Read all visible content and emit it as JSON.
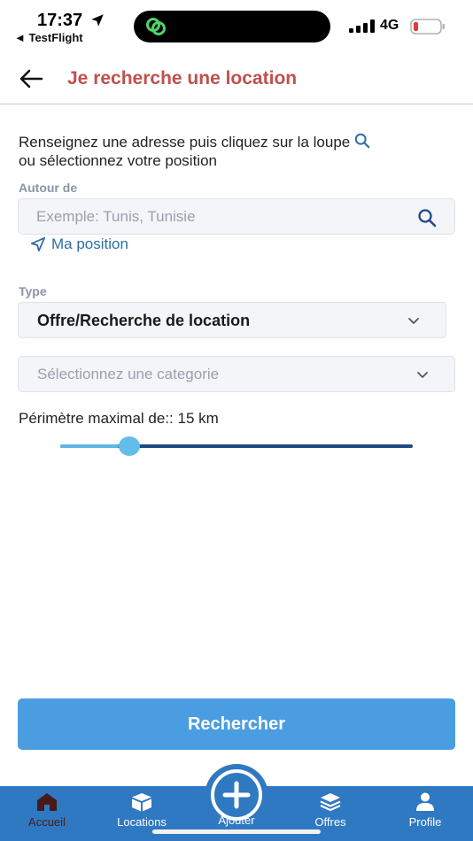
{
  "status_bar": {
    "time": "17:37",
    "back_app": "◄ TestFlight",
    "network": "4G"
  },
  "header": {
    "title": "Je recherche une location"
  },
  "form": {
    "instructions_line1": "Renseignez une adresse puis cliquez sur la loupe",
    "instructions_line2": "ou sélectionnez votre position",
    "address_label": "Autour de",
    "address_placeholder": "Exemple: Tunis, Tunisie",
    "address_value": "",
    "my_position": "Ma position",
    "type_label": "Type",
    "type_value": "Offre/Recherche de location",
    "category_placeholder": "Sélectionnez une categorie",
    "perimeter_text": "Périmètre maximal de:: 15 km",
    "perimeter_value_km": 15,
    "perimeter_slider_fraction": 0.165,
    "search_button": "Rechercher"
  },
  "bottom_nav": {
    "items": [
      {
        "label": "Accueil",
        "icon": "home-icon",
        "active": true
      },
      {
        "label": "Locations",
        "icon": "box-icon",
        "active": false
      },
      {
        "label": "Ajouter",
        "icon": "plus-circle-icon",
        "active": false
      },
      {
        "label": "Offres",
        "icon": "layers-icon",
        "active": false
      },
      {
        "label": "Profile",
        "icon": "user-icon",
        "active": false
      }
    ]
  },
  "colors": {
    "title": "#c0504d",
    "primary": "#4a9de0",
    "nav_bg": "#2f78c2",
    "link": "#2d6da8",
    "active_nav": "#4a1a1a"
  }
}
